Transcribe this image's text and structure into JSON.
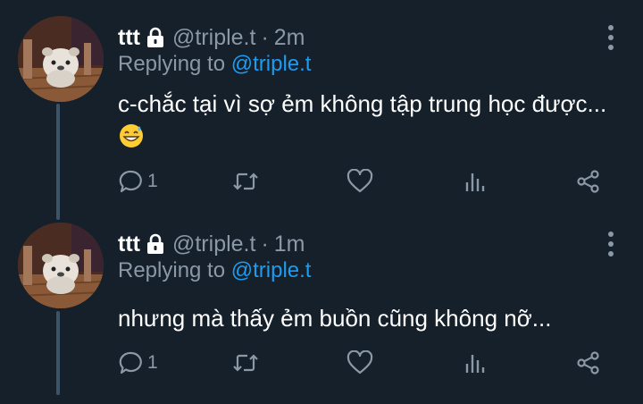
{
  "colors": {
    "background": "#15202b",
    "primary_text": "#ffffff",
    "secondary_text": "#8b98a5",
    "link": "#1d9bf0",
    "thread_line": "#3d5466"
  },
  "tweets": [
    {
      "display_name": "ttt",
      "verified_lock_icon": "lock-icon",
      "handle": "@triple.t",
      "separator": "·",
      "time": "2m",
      "replying_prefix": "Replying to ",
      "replying_to": "@triple.t",
      "text": "c-chắc tại vì sợ ẻm không tập trung học được...",
      "emoji": "grinning-sweat-emoji",
      "actions": {
        "reply_count": "1",
        "retweet_count": "",
        "like_count": "",
        "icons": [
          "reply-icon",
          "retweet-icon",
          "like-icon",
          "analytics-icon",
          "share-icon"
        ]
      }
    },
    {
      "display_name": "ttt",
      "verified_lock_icon": "lock-icon",
      "handle": "@triple.t",
      "separator": "·",
      "time": "1m",
      "replying_prefix": "Replying to ",
      "replying_to": "@triple.t",
      "text": "nhưng mà thấy ẻm buồn cũng không nỡ...",
      "actions": {
        "reply_count": "1",
        "retweet_count": "",
        "like_count": "",
        "icons": [
          "reply-icon",
          "retweet-icon",
          "like-icon",
          "analytics-icon",
          "share-icon"
        ]
      }
    }
  ]
}
